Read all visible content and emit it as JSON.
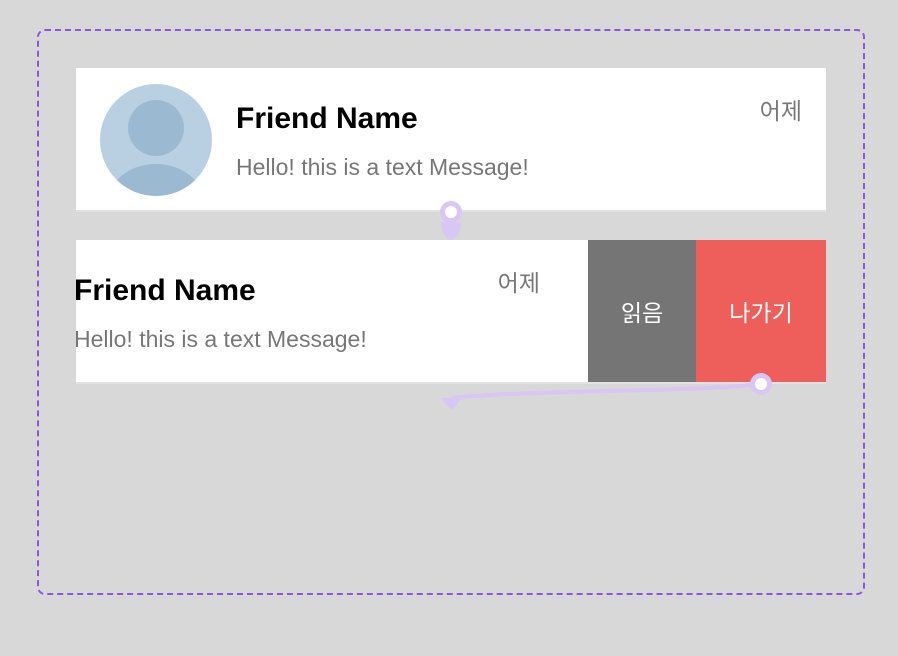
{
  "chat_list": {
    "row1": {
      "name": "Friend Name",
      "message": "Hello! this is a text Message!",
      "time": "어제"
    },
    "row2": {
      "name": "Friend Name",
      "message": "Hello! this is a text Message!",
      "time": "어제",
      "actions": {
        "read_label": "읽음",
        "leave_label": "나가기"
      }
    }
  },
  "colors": {
    "frame_border": "#8b55e6",
    "read_action": "#757575",
    "leave_action": "#ee5f5b",
    "avatar_bg": "#b9d0e3",
    "connector": "#d8c6f4"
  },
  "icons": {
    "avatar": "person-placeholder-icon"
  }
}
